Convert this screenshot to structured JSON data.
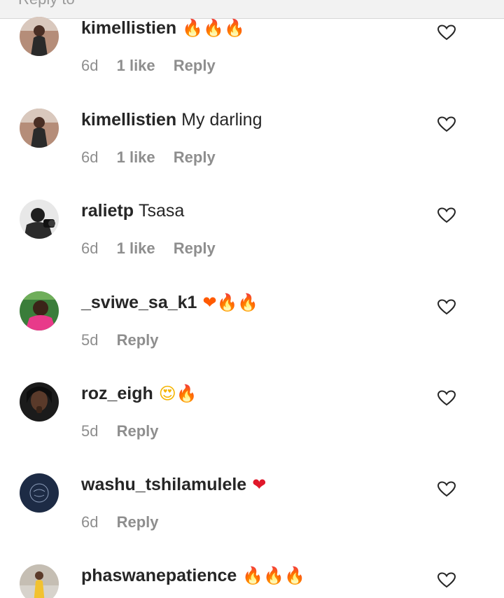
{
  "top_fragment": "Reply to",
  "comments": [
    {
      "username": "kimellistien",
      "text": "",
      "emoji": "🔥🔥🔥",
      "age": "6d",
      "likes": "1 like",
      "reply": "Reply"
    },
    {
      "username": "kimellistien",
      "text": "My darling",
      "emoji": "",
      "age": "6d",
      "likes": "1 like",
      "reply": "Reply"
    },
    {
      "username": "ralietp",
      "text": "Tsasa",
      "emoji": "",
      "age": "6d",
      "likes": "1 like",
      "reply": "Reply"
    },
    {
      "username": "_sviwe_sa_k1",
      "text": "",
      "emoji": "❤🔥🔥",
      "age": "5d",
      "likes": "",
      "reply": "Reply"
    },
    {
      "username": "roz_eigh",
      "text": "",
      "emoji": "😍🔥",
      "age": "5d",
      "likes": "",
      "reply": "Reply"
    },
    {
      "username": "washu_tshilamulele",
      "text": "",
      "emoji": "❤",
      "age": "6d",
      "likes": "",
      "reply": "Reply"
    },
    {
      "username": "phaswanepatience",
      "text": "",
      "emoji": "🔥🔥🔥",
      "age": "",
      "likes": "",
      "reply": ""
    }
  ],
  "icons": {
    "like": "heart-outline-icon"
  }
}
